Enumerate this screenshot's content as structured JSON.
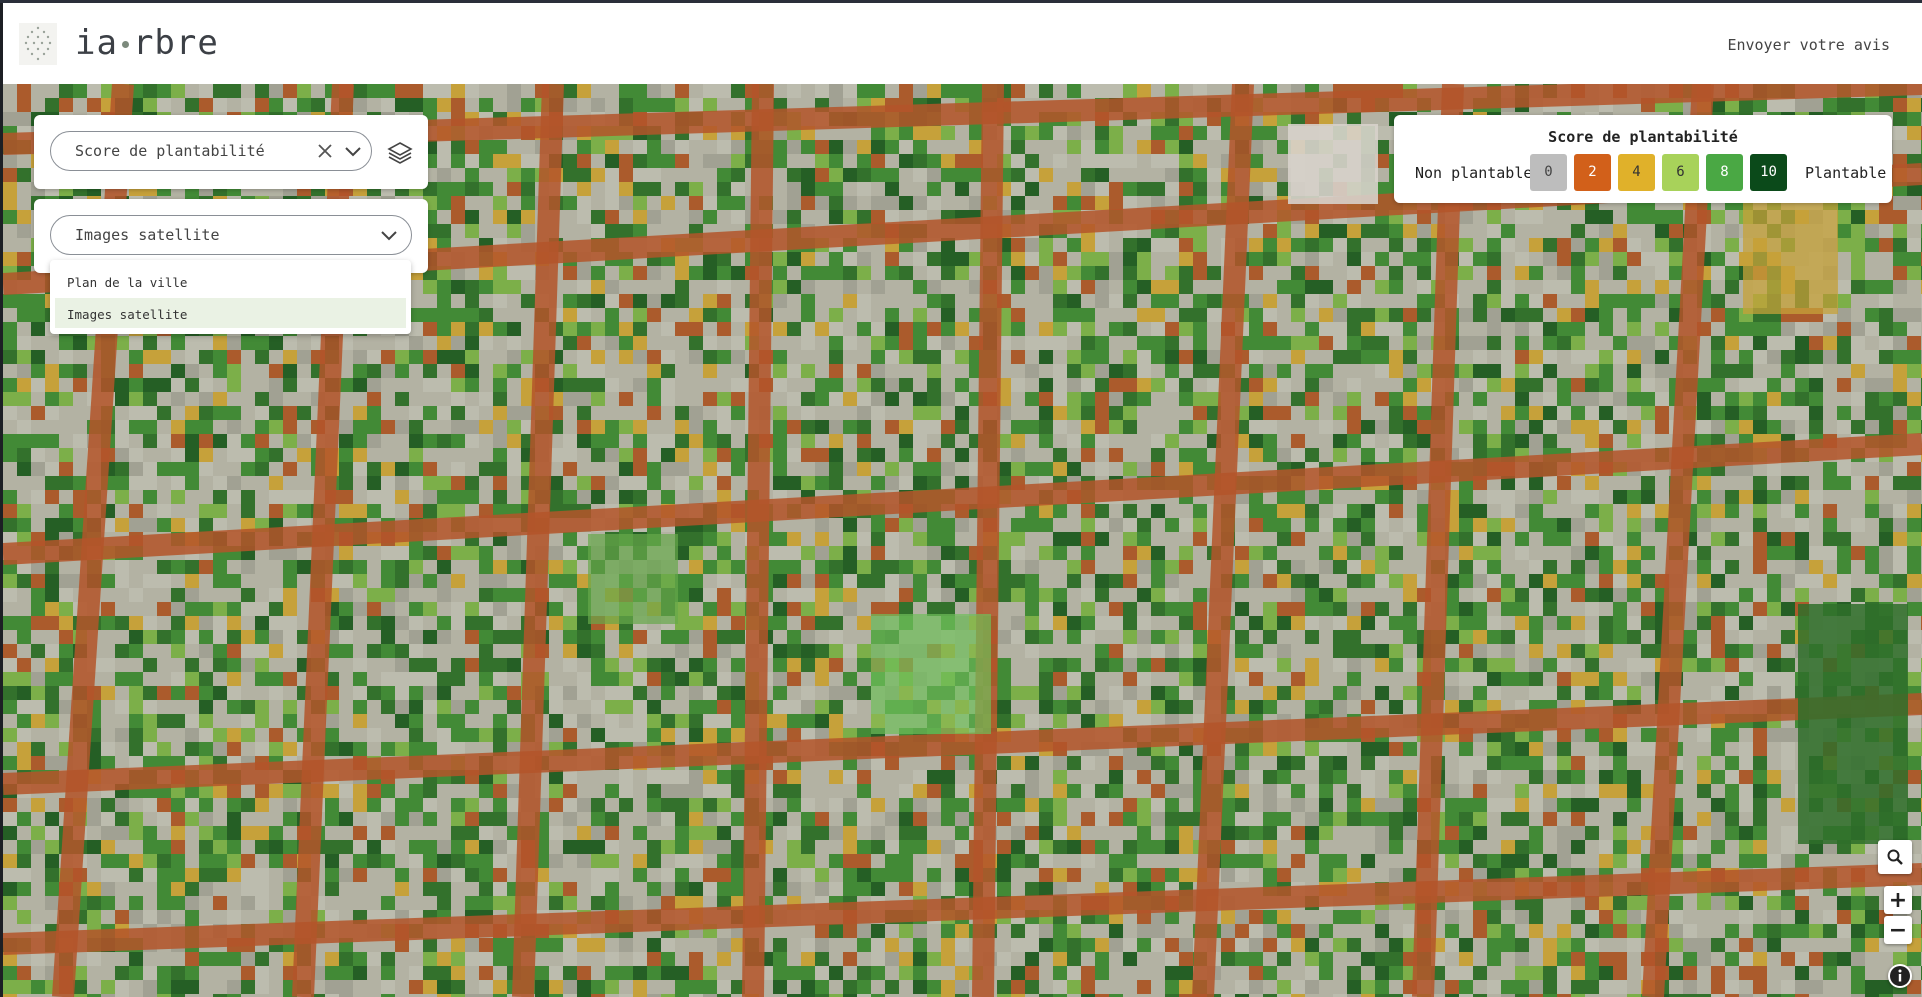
{
  "app": {
    "logo_left": "ia",
    "logo_right": "rbre",
    "feedback_link": "Envoyer votre avis"
  },
  "layer_select": {
    "value": "Score de plantabilité",
    "clear_icon": "close-icon",
    "toggle_icon": "chevron-down-icon",
    "layers_icon": "layers-icon"
  },
  "basemap_select": {
    "value": "Images satellite",
    "toggle_icon": "chevron-down-icon",
    "options": [
      "Plan de la ville",
      "Images satellite"
    ],
    "selected_index": 1
  },
  "legend": {
    "title": "Score de plantabilité",
    "min_label": "Non plantable",
    "max_label": "Plantable",
    "swatches": [
      {
        "label": "0",
        "color": "#bdbdbd",
        "text_color": "#444444"
      },
      {
        "label": "2",
        "color": "#d2601a",
        "text_color": "#ffffff"
      },
      {
        "label": "4",
        "color": "#e0b12a",
        "text_color": "#333333"
      },
      {
        "label": "6",
        "color": "#a8d25a",
        "text_color": "#333333"
      },
      {
        "label": "8",
        "color": "#4aa844",
        "text_color": "#ffffff"
      },
      {
        "label": "10",
        "color": "#0b4a1a",
        "text_color": "#ffffff"
      }
    ]
  },
  "map_controls": {
    "search_icon": "search-icon",
    "zoom_in": "+",
    "zoom_out": "−",
    "info_icon": "info-icon"
  },
  "colors": {
    "accent_selected": "#eaf2e4",
    "road_overlay": "#b4552a",
    "vegetation": "#3f8a35",
    "building": "#bdb6ae"
  }
}
